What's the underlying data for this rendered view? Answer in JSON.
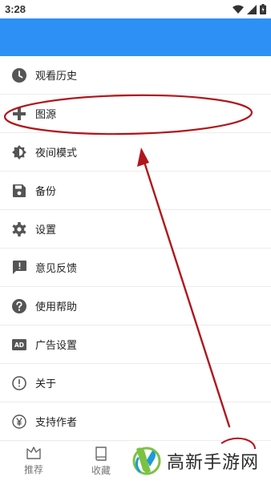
{
  "status_bar": {
    "time": "3:28"
  },
  "menu": {
    "items": [
      {
        "label": "观看历史",
        "icon": "clock-icon"
      },
      {
        "label": "图源",
        "icon": "plus-icon"
      },
      {
        "label": "夜间模式",
        "icon": "brightness-icon"
      },
      {
        "label": "备份",
        "icon": "save-icon"
      },
      {
        "label": "设置",
        "icon": "gear-icon"
      },
      {
        "label": "意见反馈",
        "icon": "feedback-icon"
      },
      {
        "label": "使用帮助",
        "icon": "help-icon"
      },
      {
        "label": "广告设置",
        "icon": "ad-icon"
      },
      {
        "label": "关于",
        "icon": "info-icon"
      },
      {
        "label": "支持作者",
        "icon": "yen-icon"
      }
    ]
  },
  "bottom_nav": {
    "tabs": [
      {
        "label": "推荐",
        "icon": "crown-icon"
      },
      {
        "label": "收藏",
        "icon": "book-icon"
      }
    ]
  },
  "watermark": {
    "text": "高新手游网"
  },
  "colors": {
    "app_bar": "#2d90f5",
    "annotation": "#b0161b",
    "icon": "#555555"
  }
}
